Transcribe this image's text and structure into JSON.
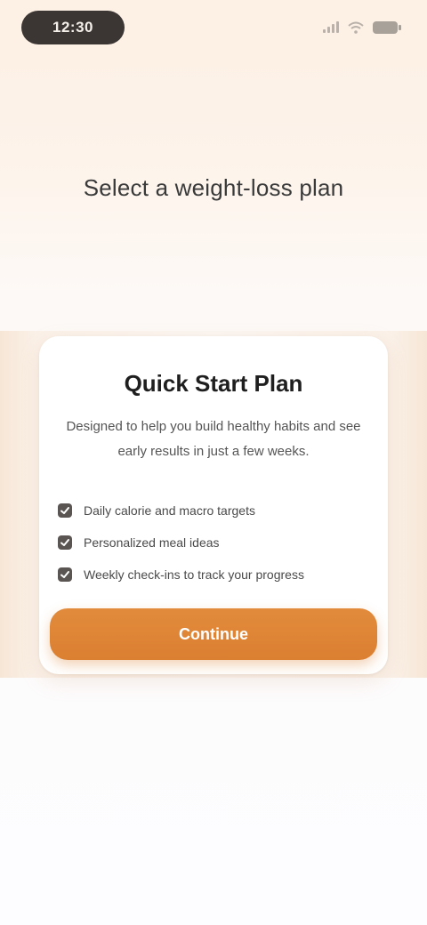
{
  "status_bar": {
    "time": "12:30",
    "icons": [
      "signal-icon",
      "wifi-icon",
      "battery-icon"
    ]
  },
  "page": {
    "title": "Select a weight-loss plan"
  },
  "card": {
    "title": "Quick Start Plan",
    "description": "Designed to help you build healthy habits and see early results in just a few weeks.",
    "features": [
      "Daily calorie and macro targets",
      "Personalized meal ideas",
      "Weekly check-ins to track your progress"
    ],
    "cta_label": "Continue"
  },
  "colors": {
    "accent": "#e08a3a",
    "background_top": "#fdf0e4",
    "card": "#ffffff",
    "check": "#4a4a4a"
  }
}
